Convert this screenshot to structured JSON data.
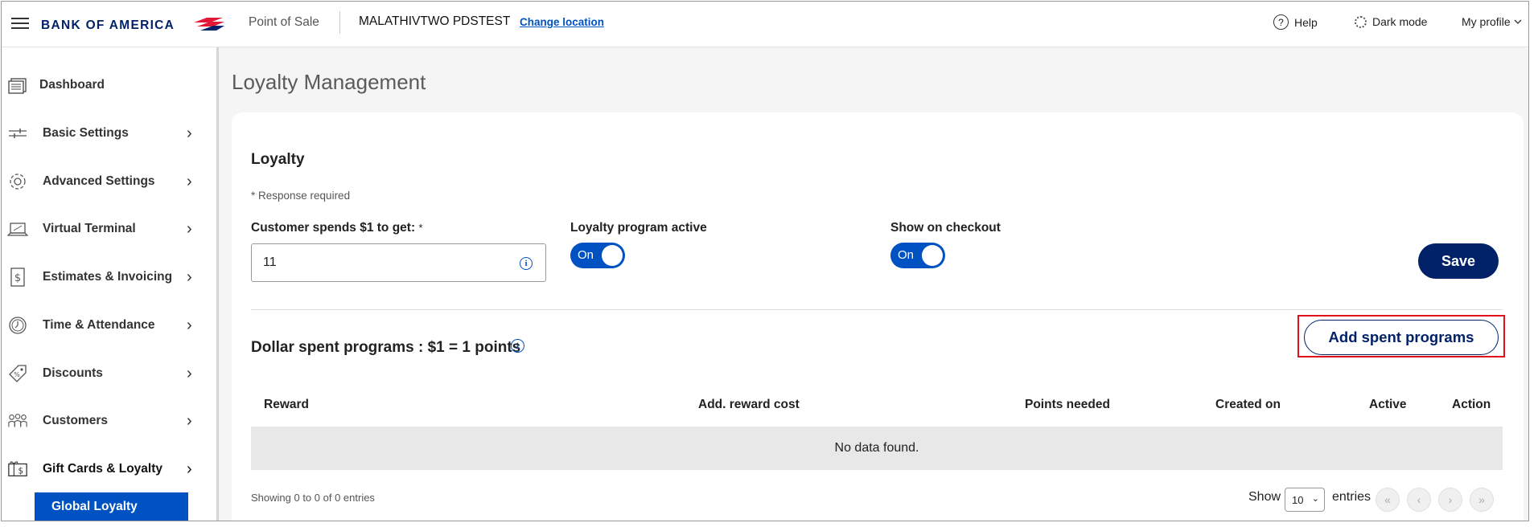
{
  "header": {
    "brand": "BANK OF AMERICA",
    "app_name": "Point of Sale",
    "merchant": "MALATHIVTWO PDSTEST",
    "change_location": "Change location",
    "help": "Help",
    "dark_mode": "Dark mode",
    "profile": "My profile"
  },
  "sidebar": {
    "items": [
      {
        "label": "Dashboard",
        "icon": "dashboard-icon"
      },
      {
        "label": "Basic Settings",
        "icon": "sliders-icon"
      },
      {
        "label": "Advanced Settings",
        "icon": "gear-icon"
      },
      {
        "label": "Virtual Terminal",
        "icon": "laptop-icon"
      },
      {
        "label": "Estimates & Invoicing",
        "icon": "invoice-icon"
      },
      {
        "label": "Time & Attendance",
        "icon": "clock-icon"
      },
      {
        "label": "Discounts",
        "icon": "tag-icon"
      },
      {
        "label": "Customers",
        "icon": "people-icon"
      },
      {
        "label": "Gift Cards & Loyalty",
        "icon": "gift-card-icon"
      }
    ],
    "active_sub_item": "Global Loyalty"
  },
  "main": {
    "title": "Loyalty Management",
    "card_title": "Loyalty",
    "required_note": "* Response required",
    "spend_label": "Customer spends $1 to get:",
    "spend_required_mark": "*",
    "spend_value": "11",
    "loyalty_active_label": "Loyalty program active",
    "loyalty_active_state": "On",
    "checkout_label": "Show on checkout",
    "checkout_state": "On",
    "save": "Save",
    "section_title": "Dollar spent programs : $1 = 1 points",
    "add_button": "Add spent programs",
    "table": {
      "columns": [
        "Reward",
        "Add. reward cost",
        "Points needed",
        "Created on",
        "Active",
        "Action"
      ],
      "empty_text": "No data found."
    },
    "footer": {
      "showing": "Showing 0 to 0 of 0 entries",
      "show": "Show",
      "page_size": "10",
      "entries": "entries",
      "pager": [
        "«",
        "‹",
        "›",
        "»"
      ]
    }
  },
  "colors": {
    "brand_navy": "#012169",
    "accent_blue": "#0052c2",
    "brand_red": "#e31837",
    "highlight_red": "#e0111b"
  }
}
